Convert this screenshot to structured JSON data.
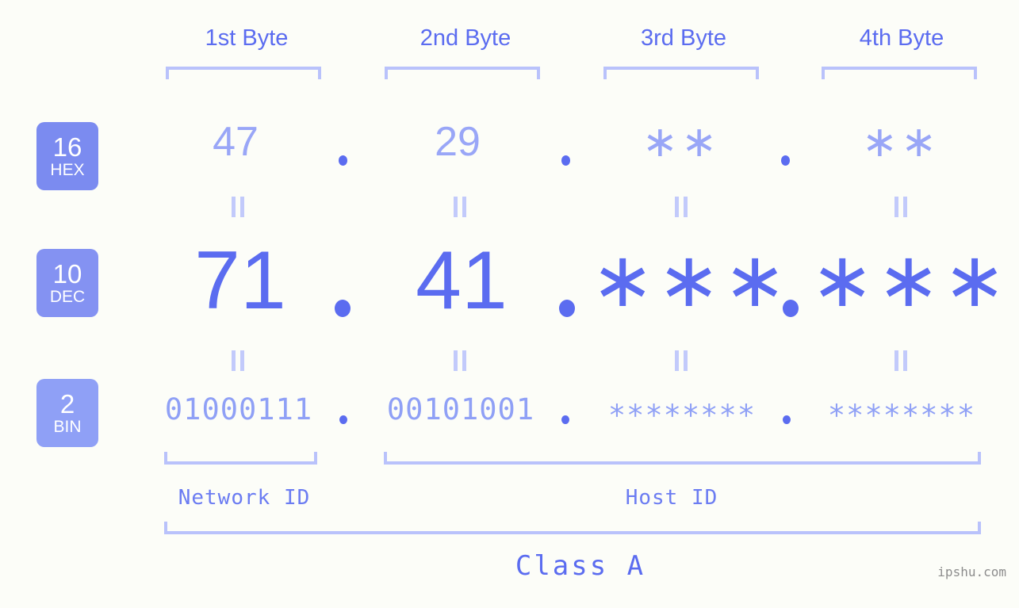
{
  "background_color": "#fcfdf8",
  "colors": {
    "accent_strong": "#5b6cf0",
    "accent_mid": "#8fa0f6",
    "accent_light": "#99a6f7",
    "bracket": "#b9c2fb",
    "badge_hex": "#7b8bf0",
    "badge_dec": "#8492f2",
    "badge_bin": "#8fa0f6",
    "watermark": "#8d8d8d"
  },
  "byte_headers": [
    {
      "label": "1st Byte"
    },
    {
      "label": "2nd Byte"
    },
    {
      "label": "3rd Byte"
    },
    {
      "label": "4th Byte"
    }
  ],
  "radix_badges": [
    {
      "number": "16",
      "name": "HEX"
    },
    {
      "number": "10",
      "name": "DEC"
    },
    {
      "number": "2",
      "name": "BIN"
    }
  ],
  "rows": {
    "hex": {
      "radix": "16",
      "values": [
        "47",
        "29",
        "∗∗",
        "∗∗"
      ],
      "separator": "."
    },
    "dec": {
      "radix": "10",
      "values": [
        "71",
        "41",
        "∗∗∗",
        "∗∗∗"
      ],
      "separator": "."
    },
    "bin": {
      "radix": "2",
      "values": [
        "01000111",
        "00101001",
        "∗∗∗∗∗∗∗∗",
        "∗∗∗∗∗∗∗∗"
      ],
      "separator": "."
    }
  },
  "equality_separator": "=",
  "regions": [
    {
      "label": "Network ID"
    },
    {
      "label": "Host ID"
    }
  ],
  "class_label": "Class A",
  "watermark": "ipshu.com"
}
